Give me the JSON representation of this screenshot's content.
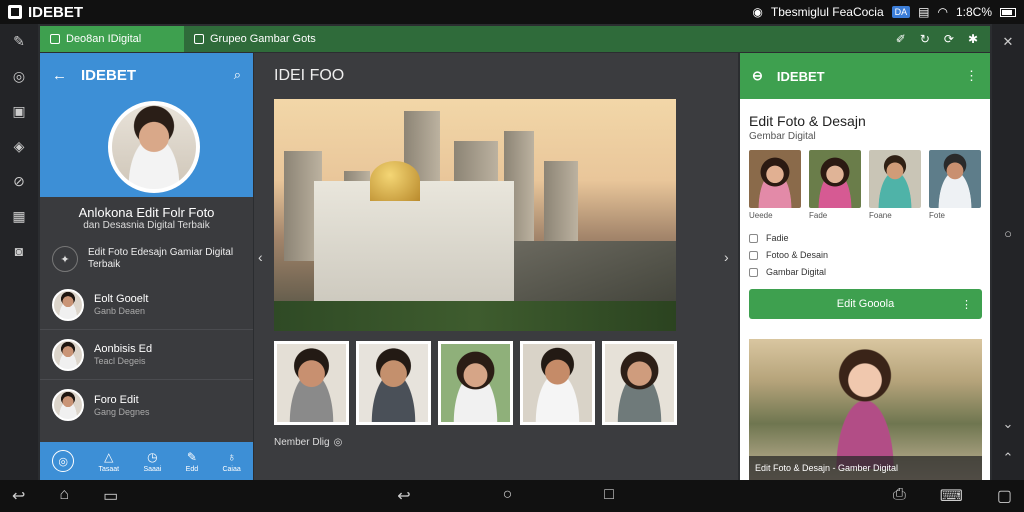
{
  "status": {
    "brand": "IDEBET",
    "app_name": "Tbesmiglul FeaCocia",
    "badge": "DA",
    "battery": "1:8C%"
  },
  "tabs": [
    {
      "label": "Deo8an IDigital"
    },
    {
      "label": "Grupeo Gambar Gots"
    }
  ],
  "left_panel": {
    "app_title": "IDEBET",
    "profile_title": "Anlokona Edit Folr Foto",
    "profile_subtitle": "dan Desasnia Digital Terbaik",
    "feature_text": "Edit Foto Edesajn Gamiar Digital Terbaik",
    "contacts": [
      {
        "name": "Eolt Gooelt",
        "sub": "Ganb Deaen"
      },
      {
        "name": "Aonbisis Ed",
        "sub": "Teacl Degeis"
      },
      {
        "name": "Foro Edit",
        "sub": "Gang Degnes"
      }
    ],
    "nav": [
      {
        "label": ""
      },
      {
        "label": "Tasaat"
      },
      {
        "label": "Saaai"
      },
      {
        "label": "Edd"
      },
      {
        "label": "Caiaa"
      }
    ]
  },
  "center": {
    "title": "IDEI FOO",
    "thumb_caption": "Nember Dlig"
  },
  "right_panel": {
    "app_title": "IDEBET",
    "title": "Edit Foto & Desajn",
    "subtitle": "Gembar Digital",
    "grid": [
      {
        "caption": "Ueede"
      },
      {
        "caption": "Fade"
      },
      {
        "caption": "Foane"
      },
      {
        "caption": "Fote"
      }
    ],
    "list": [
      "Fadie",
      "Fotoo & Desain",
      "Gambar Digital"
    ],
    "button_label": "Edit Gooola",
    "card_caption": "Edit Foto & Desajn - Gamber Digital"
  }
}
